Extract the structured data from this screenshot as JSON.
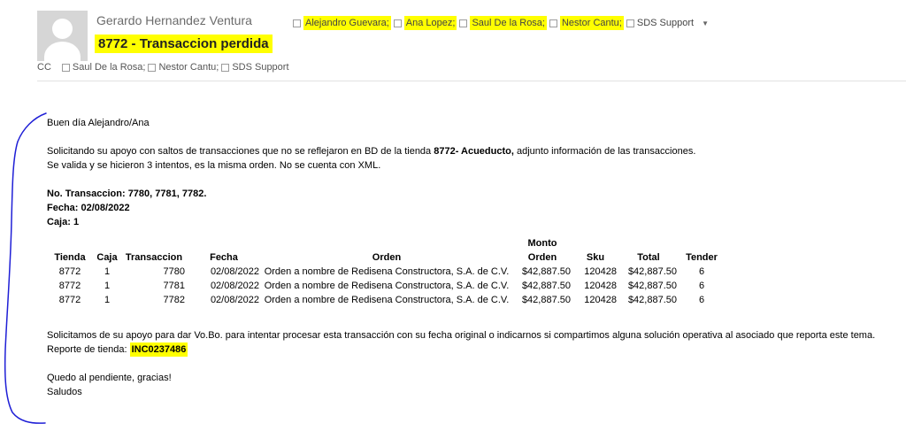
{
  "header": {
    "sender": "Gerardo Hernandez Ventura",
    "subject": "8772 - Transaccion perdida",
    "to": [
      {
        "name": "Alejandro Guevara;",
        "highlighted": true
      },
      {
        "name": "Ana Lopez;",
        "highlighted": true
      },
      {
        "name": "Saul De la Rosa;",
        "highlighted": true
      },
      {
        "name": "Nestor Cantu;",
        "highlighted": true
      },
      {
        "name": "SDS Support",
        "highlighted": false
      }
    ],
    "cc_label": "CC",
    "cc": [
      "Saul De la Rosa;",
      "Nestor Cantu;",
      "SDS Support"
    ]
  },
  "body": {
    "greeting": "Buen día Alejandro/Ana",
    "p1_before": "Solicitando su apoyo con saltos de transacciones que no se reflejaron en BD de la tienda ",
    "p1_bold": "8772- Acueducto,",
    "p1_after": " adjunto información de las transacciones.",
    "p2": "Se valida y se hicieron 3 intentos, es la misma orden. No se cuenta con XML.",
    "tx_numbers": "No. Transaccion: 7780, 7781, 7782.",
    "fecha": "Fecha: 02/08/2022",
    "caja": "Caja:  1",
    "closing1": "Solicitamos de su apoyo para dar Vo.Bo. para intentar procesar esta transacción con su fecha original o indicarnos si compartimos alguna solución operativa al asociado que reporta este tema.",
    "report_label": "Reporte de tienda:",
    "report_id": "INC0237486",
    "closing2": "Quedo al pendiente, gracias!",
    "closing3": "Saludos"
  },
  "table": {
    "headers": [
      "Tienda",
      "Caja",
      "Transaccion",
      "Fecha",
      "Orden",
      "Monto\nOrden",
      "Sku",
      "Total",
      "Tender"
    ],
    "rows": [
      [
        "8772",
        "1",
        "7780",
        "02/08/2022",
        "Orden a nombre de Redisena Constructora, S.A. de C.V.",
        "$42,887.50",
        "120428",
        "$42,887.50",
        "6"
      ],
      [
        "8772",
        "1",
        "7781",
        "02/08/2022",
        "Orden a nombre de Redisena Constructora, S.A. de C.V.",
        "$42,887.50",
        "120428",
        "$42,887.50",
        "6"
      ],
      [
        "8772",
        "1",
        "7782",
        "02/08/2022",
        "Orden a nombre de Redisena Constructora, S.A. de C.V.",
        "$42,887.50",
        "120428",
        "$42,887.50",
        "6"
      ]
    ]
  },
  "colors": {
    "highlight": "#ffff00",
    "annotation_stroke": "#1f1fd6"
  }
}
